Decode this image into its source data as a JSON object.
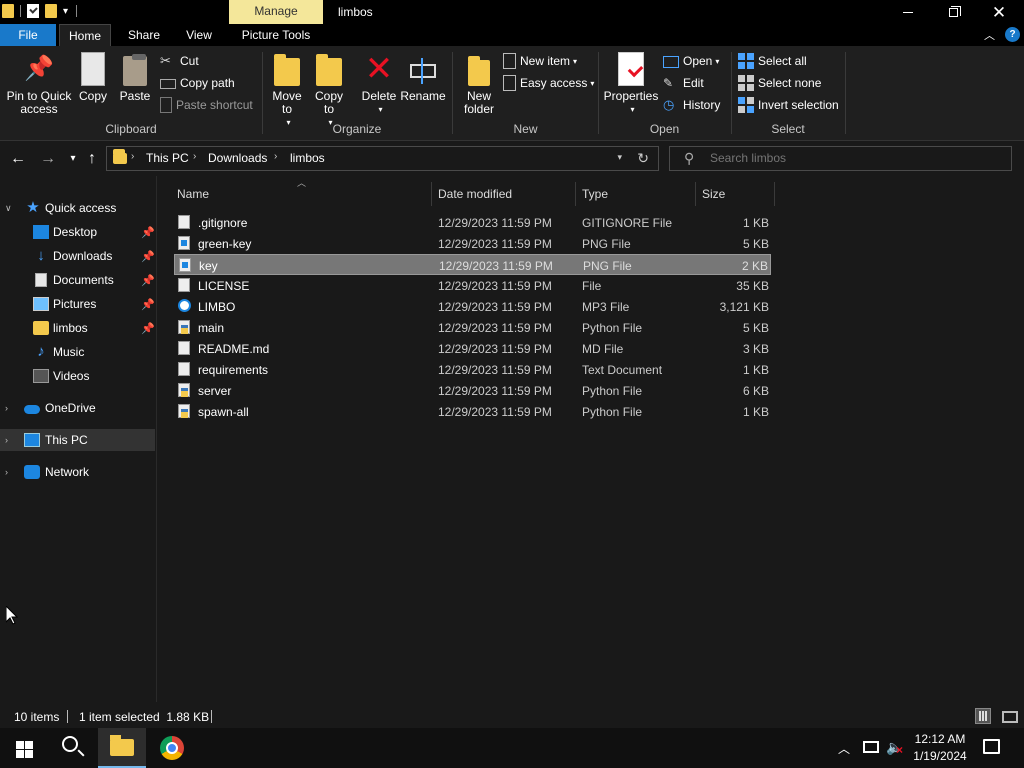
{
  "window": {
    "title": "limbos",
    "manage_tab": "Manage",
    "close_glyph": "✕"
  },
  "tabs": {
    "file": "File",
    "home": "Home",
    "share": "Share",
    "view": "View",
    "picture_tools": "Picture Tools"
  },
  "ribbon": {
    "clipboard": {
      "label": "Clipboard",
      "pin": "Pin to Quick access",
      "copy": "Copy",
      "paste": "Paste",
      "cut": "Cut",
      "copy_path": "Copy path",
      "paste_shortcut": "Paste shortcut"
    },
    "organize": {
      "label": "Organize",
      "move_to": "Move to",
      "copy_to": "Copy to",
      "delete": "Delete",
      "rename": "Rename"
    },
    "new": {
      "label": "New",
      "new_folder": "New folder",
      "new_item": "New item",
      "easy_access": "Easy access"
    },
    "open": {
      "label": "Open",
      "properties": "Properties",
      "open": "Open",
      "edit": "Edit",
      "history": "History"
    },
    "select": {
      "label": "Select",
      "select_all": "Select all",
      "select_none": "Select none",
      "invert_selection": "Invert selection"
    }
  },
  "address": {
    "crumbs": [
      "This PC",
      "Downloads",
      "limbos"
    ],
    "search_placeholder": "Search limbos"
  },
  "nav_pane": {
    "quick_access": "Quick access",
    "items": [
      "Desktop",
      "Downloads",
      "Documents",
      "Pictures",
      "limbos",
      "Music",
      "Videos"
    ],
    "onedrive": "OneDrive",
    "this_pc": "This PC",
    "network": "Network"
  },
  "columns": {
    "name": "Name",
    "date": "Date modified",
    "type": "Type",
    "size": "Size"
  },
  "files": [
    {
      "name": ".gitignore",
      "date": "12/29/2023 11:59 PM",
      "type": "GITIGNORE File",
      "size": "1 KB",
      "icon": "doc-icon"
    },
    {
      "name": "green-key",
      "date": "12/29/2023 11:59 PM",
      "type": "PNG File",
      "size": "5 KB",
      "icon": "image-icon"
    },
    {
      "name": "key",
      "date": "12/29/2023 11:59 PM",
      "type": "PNG File",
      "size": "2 KB",
      "icon": "image-icon",
      "selected": true
    },
    {
      "name": "LICENSE",
      "date": "12/29/2023 11:59 PM",
      "type": "File",
      "size": "35 KB",
      "icon": "doc-icon"
    },
    {
      "name": "LIMBO",
      "date": "12/29/2023 11:59 PM",
      "type": "MP3 File",
      "size": "3,121 KB",
      "icon": "audio-icon"
    },
    {
      "name": "main",
      "date": "12/29/2023 11:59 PM",
      "type": "Python File",
      "size": "5 KB",
      "icon": "python-icon"
    },
    {
      "name": "README.md",
      "date": "12/29/2023 11:59 PM",
      "type": "MD File",
      "size": "3 KB",
      "icon": "doc-icon"
    },
    {
      "name": "requirements",
      "date": "12/29/2023 11:59 PM",
      "type": "Text Document",
      "size": "1 KB",
      "icon": "doc-icon"
    },
    {
      "name": "server",
      "date": "12/29/2023 11:59 PM",
      "type": "Python File",
      "size": "6 KB",
      "icon": "python-icon"
    },
    {
      "name": "spawn-all",
      "date": "12/29/2023 11:59 PM",
      "type": "Python File",
      "size": "1 KB",
      "icon": "python-icon"
    }
  ],
  "status": {
    "count": "10 items",
    "selected": "1 item selected  1.88 KB"
  },
  "taskbar": {
    "time": "12:12 AM",
    "date": "1/19/2024"
  },
  "colors": {
    "accent": "#1979ca",
    "manage_tab": "#f4e79a",
    "folder": "#f3c94c",
    "delete": "#e81123"
  }
}
